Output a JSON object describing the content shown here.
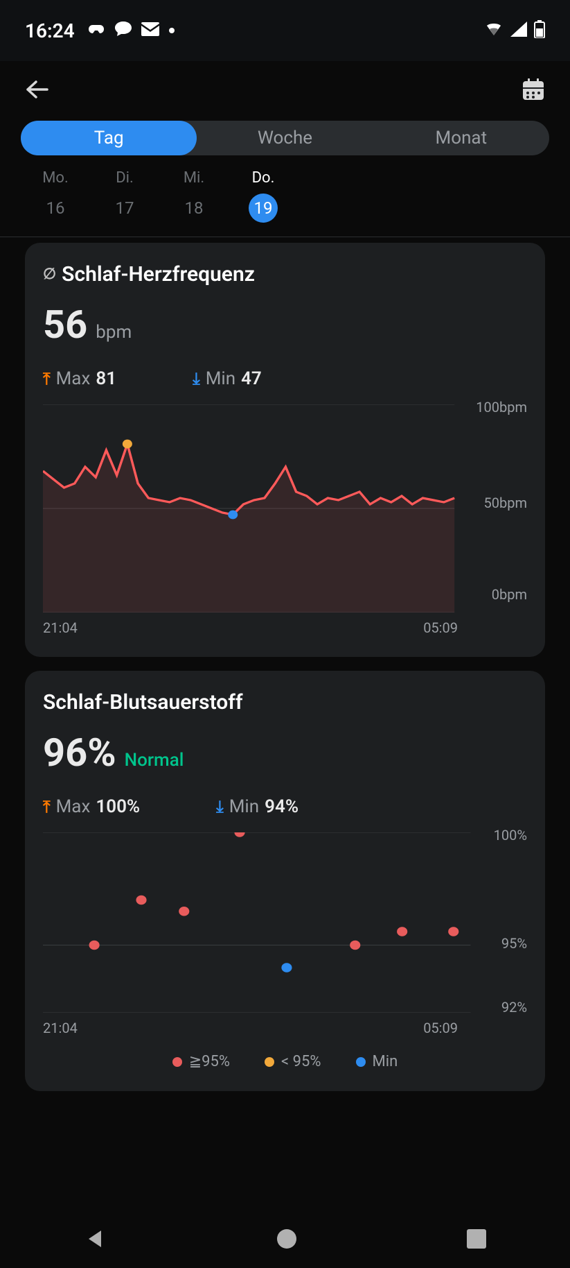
{
  "status_bar": {
    "time": "16:24"
  },
  "tabs": {
    "items": [
      "Tag",
      "Woche",
      "Monat"
    ],
    "active_index": 0
  },
  "day_picker": {
    "days": [
      {
        "label": "Mo.",
        "num": "16",
        "selected": false
      },
      {
        "label": "Di.",
        "num": "17",
        "selected": false
      },
      {
        "label": "Mi.",
        "num": "18",
        "selected": false
      },
      {
        "label": "Do.",
        "num": "19",
        "selected": true
      }
    ]
  },
  "heart_rate_card": {
    "title": "Schlaf-Herzfrequenz",
    "value": "56",
    "unit": "bpm",
    "max_label": "Max",
    "max_value": "81",
    "min_label": "Min",
    "min_value": "47",
    "y_top": "100bpm",
    "y_mid": "50bpm",
    "y_bottom": "0bpm",
    "x_start": "21:04",
    "x_end": "05:09"
  },
  "spo2_card": {
    "title": "Schlaf-Blutsauerstoff",
    "value": "96%",
    "status": "Normal",
    "max_label": "Max",
    "max_value": "100%",
    "min_label": "Min",
    "min_value": "94%",
    "y_top": "100%",
    "y_mid": "95%",
    "y_bottom": "92%",
    "x_start": "21:04",
    "x_end": "05:09",
    "legend": {
      "high": "≧95%",
      "low": "< 95%",
      "min": "Min"
    }
  },
  "chart_data": [
    {
      "type": "line",
      "title": "Schlaf-Herzfrequenz",
      "xlabel": "",
      "ylabel": "bpm",
      "ylim": [
        0,
        100
      ],
      "x_range": [
        "21:04",
        "05:09"
      ],
      "y_ticks": [
        0,
        50,
        100
      ],
      "annotations": {
        "max_point": 81,
        "min_point": 47
      },
      "values": [
        68,
        64,
        60,
        62,
        70,
        65,
        78,
        66,
        81,
        62,
        55,
        54,
        53,
        55,
        54,
        52,
        50,
        48,
        47,
        52,
        54,
        55,
        62,
        70,
        58,
        56,
        52,
        55,
        54,
        56,
        58,
        52,
        55,
        53,
        56,
        52,
        55,
        54,
        53,
        55
      ]
    },
    {
      "type": "scatter",
      "title": "Schlaf-Blutsauerstoff",
      "xlabel": "",
      "ylabel": "%",
      "ylim": [
        92,
        100
      ],
      "x_range": [
        "21:04",
        "05:09"
      ],
      "y_ticks": [
        92,
        95,
        100
      ],
      "legend_entries": [
        "≧95%",
        "< 95%",
        "Min"
      ],
      "series": [
        {
          "name": "≧95%",
          "color": "#e85c5c",
          "points": [
            {
              "x": 0.12,
              "y": 95
            },
            {
              "x": 0.23,
              "y": 97
            },
            {
              "x": 0.33,
              "y": 96.5
            },
            {
              "x": 0.46,
              "y": 100
            },
            {
              "x": 0.73,
              "y": 95
            },
            {
              "x": 0.84,
              "y": 95.6
            },
            {
              "x": 0.96,
              "y": 95.6
            }
          ]
        },
        {
          "name": "< 95%",
          "color": "#f2a93b",
          "points": []
        },
        {
          "name": "Min",
          "color": "#2e8cf0",
          "points": [
            {
              "x": 0.57,
              "y": 94
            }
          ]
        }
      ]
    }
  ]
}
